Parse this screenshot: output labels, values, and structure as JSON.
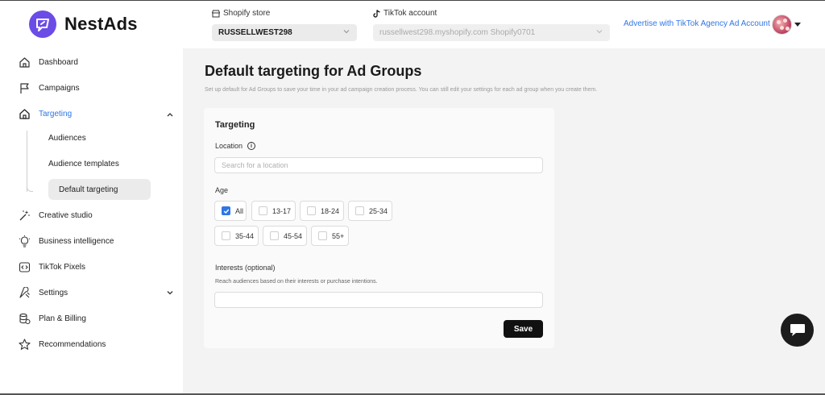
{
  "brand": {
    "name": "NestAds"
  },
  "header": {
    "store_label": "Shopify store",
    "store_value": "RUSSELLWEST298",
    "tiktok_label": "TikTok account",
    "tiktok_value": "russellwest298.myshopify.com Shopify0701",
    "advertise_link": "Advertise with TikTok Agency Ad Account"
  },
  "sidebar": {
    "items": [
      {
        "label": "Dashboard",
        "icon": "home-icon"
      },
      {
        "label": "Campaigns",
        "icon": "flag-icon"
      },
      {
        "label": "Targeting",
        "icon": "targeting-icon",
        "active": true
      },
      {
        "label": "Creative studio",
        "icon": "magic-wand-icon"
      },
      {
        "label": "Business intelligence",
        "icon": "lightbulb-icon"
      },
      {
        "label": "TikTok Pixels",
        "icon": "code-icon"
      },
      {
        "label": "Settings",
        "icon": "tools-icon"
      },
      {
        "label": "Plan & Billing",
        "icon": "coins-icon"
      },
      {
        "label": "Recommendations",
        "icon": "star-icon"
      }
    ],
    "targeting_sub": [
      "Audiences",
      "Audience templates",
      "Default targeting"
    ]
  },
  "main": {
    "title": "Default targeting for Ad Groups",
    "subtitle": "Set up default for Ad Groups to save your time in your ad campaign creation process. You can still edit your settings for each ad group when you create them.",
    "card": {
      "title": "Targeting",
      "location_label": "Location",
      "location_placeholder": "Search for a location",
      "age_label": "Age",
      "ages": [
        {
          "label": "All",
          "checked": true
        },
        {
          "label": "13-17",
          "checked": false
        },
        {
          "label": "18-24",
          "checked": false
        },
        {
          "label": "25-34",
          "checked": false
        },
        {
          "label": "35-44",
          "checked": false
        },
        {
          "label": "45-54",
          "checked": false
        },
        {
          "label": "55+",
          "checked": false
        }
      ],
      "interests_label": "Interests (optional)",
      "interests_hint": "Reach audiences based on their interests or purchase intentions.",
      "interests_value": "",
      "save_label": "Save"
    }
  },
  "colors": {
    "accent": "#2f76e6",
    "brand": "#6b4ce6",
    "button": "#111111"
  }
}
